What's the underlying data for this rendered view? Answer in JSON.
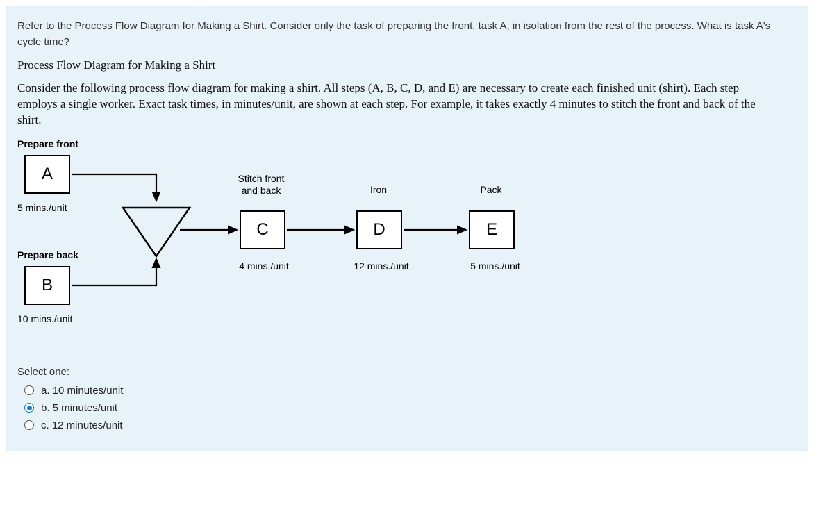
{
  "question": {
    "prompt": "Refer to the Process Flow Diagram for Making a Shirt. Consider only the task of preparing the front, task A, in isolation from the rest of the process. What is task A's cycle time?",
    "diagram_title": "Process Flow Diagram for Making a Shirt",
    "diagram_desc": "Consider the following process flow diagram for making a shirt. All steps (A, B, C, D, and E) are necessary to create each finished unit (shirt). Each step employs a single worker. Exact task times, in minutes/unit, are shown at each step. For example, it takes exactly 4 minutes to stitch the front and back of the shirt."
  },
  "diagram": {
    "labels": {
      "prepare_front": "Prepare front",
      "prepare_back": "Prepare back",
      "stitch": "Stitch front\nand back",
      "iron": "Iron",
      "pack": "Pack"
    },
    "boxes": {
      "A": "A",
      "B": "B",
      "C": "C",
      "D": "D",
      "E": "E"
    },
    "times": {
      "A": "5 mins./unit",
      "B": "10 mins./unit",
      "C": "4 mins./unit",
      "D": "12 mins./unit",
      "E": "5 mins./unit"
    }
  },
  "answers": {
    "select_label": "Select one:",
    "options": [
      {
        "id": "a",
        "label": "a. 10 minutes/unit",
        "checked": false
      },
      {
        "id": "b",
        "label": "b. 5 minutes/unit",
        "checked": true
      },
      {
        "id": "c",
        "label": "c. 12 minutes/unit",
        "checked": false
      }
    ]
  }
}
